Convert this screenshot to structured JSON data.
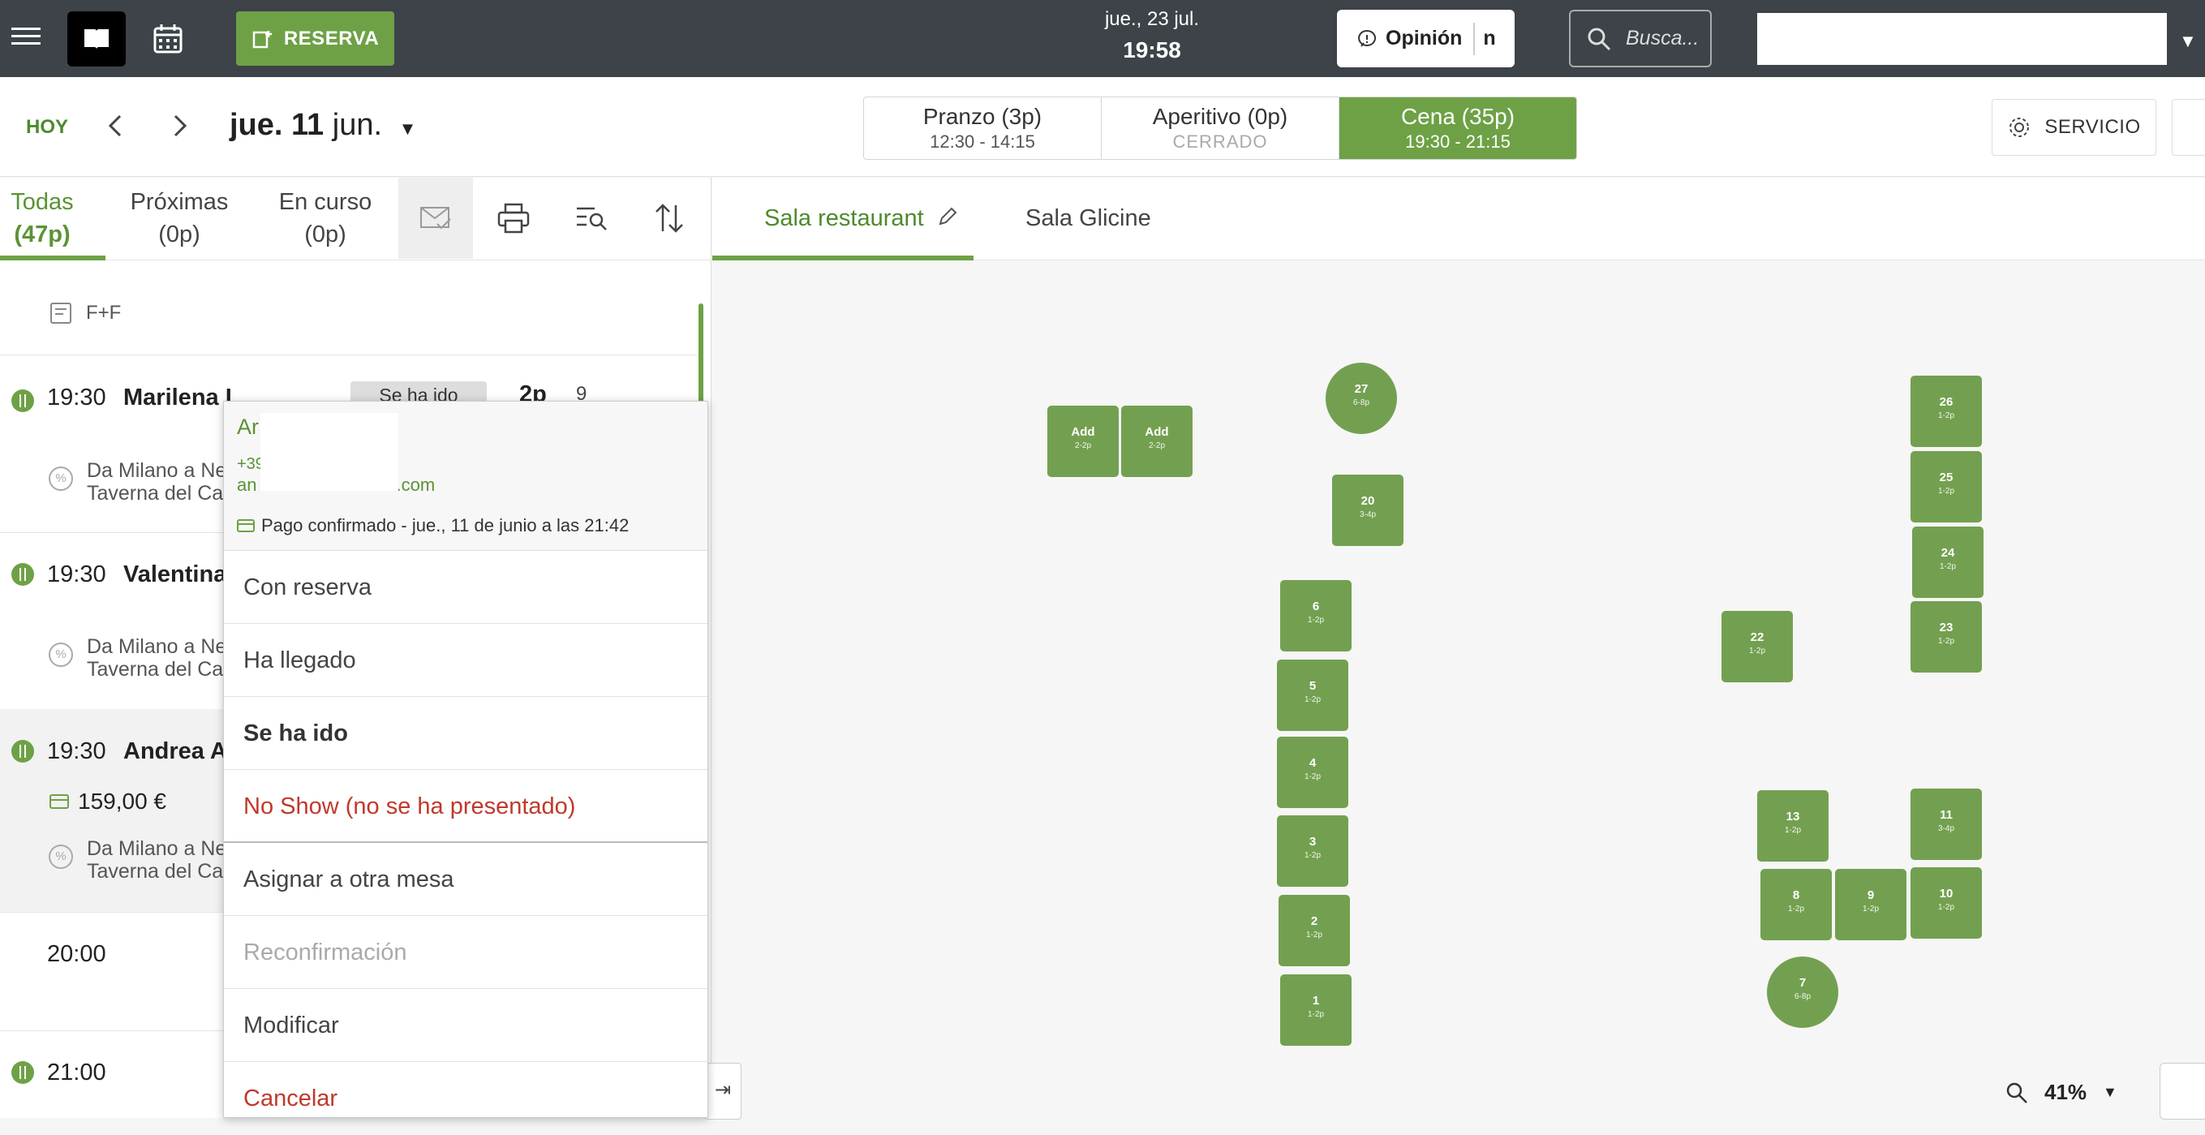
{
  "topbar": {
    "reserve_label": "RESERVA",
    "date": "jue., 23 jul.",
    "time": "19:58",
    "opinion_label": "Opinión",
    "opinion_suffix": "n",
    "search_placeholder": "Busca..."
  },
  "subbar": {
    "today_label": "HOY",
    "date_day": "jue. 11",
    "date_month": "jun.",
    "services": [
      {
        "name": "Pranzo  (3p)",
        "hours": "12:30 - 14:15"
      },
      {
        "name": "Aperitivo  (0p)",
        "hours": "CERRADO"
      },
      {
        "name": "Cena  (35p)",
        "hours": "19:30 - 21:15"
      }
    ],
    "service_button": "SERVICIO"
  },
  "list_tabs": [
    {
      "l1": "Todas",
      "l2": "(47p)"
    },
    {
      "l1": "Próximas",
      "l2": "(0p)"
    },
    {
      "l1": "En curso",
      "l2": "(0p)"
    }
  ],
  "list": {
    "note": "F+F",
    "rows": [
      {
        "time": "19:30",
        "name": "Marilena I",
        "status": "Se ha ido",
        "pax": "2p",
        "table": "9",
        "desc1": "Da Milano a Ne",
        "desc2": "Taverna del Ca"
      },
      {
        "time": "19:30",
        "name": "Valentina",
        "desc1": "Da Milano a Ne",
        "desc2": "Taverna del Ca"
      },
      {
        "time": "19:30",
        "name": "Andrea A",
        "price": "159,00 €",
        "desc1": "Da Milano a Ne",
        "desc2": "Taverna del Ca"
      }
    ],
    "slot_2000": "20:00",
    "slot_2100": "21:00"
  },
  "popup": {
    "name": "Ar",
    "phone": "+39",
    "email_prefix": "an",
    "email_suffix": "ail.com",
    "payment": "Pago confirmado - jue., 11 de junio a las 21:42",
    "items": [
      "Con reserva",
      "Ha llegado",
      "Se ha ido",
      "No Show (no se ha presentado)",
      "Asignar a otra mesa",
      "Reconfirmación",
      "Modificar",
      "Cancelar"
    ]
  },
  "room_tabs": [
    "Sala restaurant",
    "Sala Glicine"
  ],
  "tables": [
    {
      "n": "27",
      "c": "6-8p",
      "round": true
    },
    {
      "n": "Add",
      "c": "2-2p"
    },
    {
      "n": "Add",
      "c": "2-2p"
    },
    {
      "n": "20",
      "c": "3-4p"
    },
    {
      "n": "6",
      "c": "1-2p"
    },
    {
      "n": "5",
      "c": "1-2p"
    },
    {
      "n": "4",
      "c": "1-2p"
    },
    {
      "n": "3",
      "c": "1-2p"
    },
    {
      "n": "2",
      "c": "1-2p"
    },
    {
      "n": "1",
      "c": "1-2p"
    },
    {
      "n": "22",
      "c": "1-2p"
    },
    {
      "n": "26",
      "c": "1-2p"
    },
    {
      "n": "25",
      "c": "1-2p"
    },
    {
      "n": "24",
      "c": "1-2p"
    },
    {
      "n": "23",
      "c": "1-2p"
    },
    {
      "n": "13",
      "c": "1-2p"
    },
    {
      "n": "11",
      "c": "3-4p"
    },
    {
      "n": "8",
      "c": "1-2p"
    },
    {
      "n": "9",
      "c": "1-2p"
    },
    {
      "n": "10",
      "c": "1-2p"
    },
    {
      "n": "7",
      "c": "6-8p",
      "round": true
    }
  ],
  "zoom": "41%"
}
